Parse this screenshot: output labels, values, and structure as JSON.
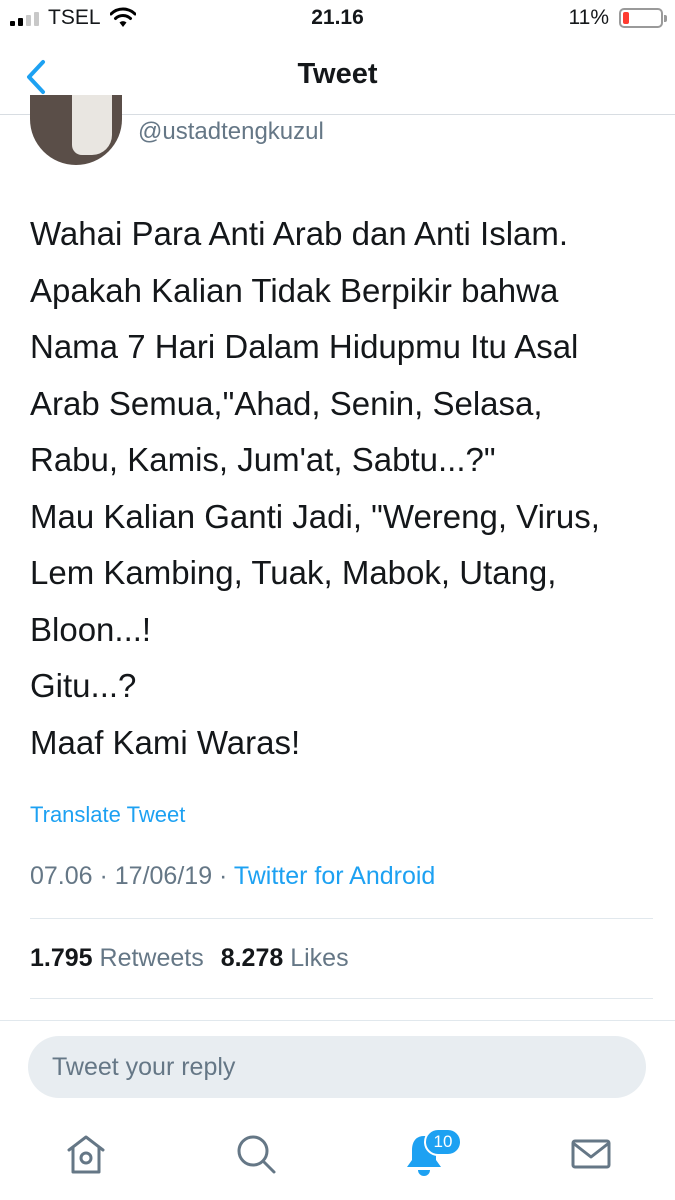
{
  "status_bar": {
    "carrier": "TSEL",
    "time": "21.16",
    "battery_percent": "11%",
    "battery_level": 0.11,
    "signal_bars": 2
  },
  "nav": {
    "title": "Tweet",
    "back_icon": "chevron-left-icon"
  },
  "tweet": {
    "handle": "@ustadtengkuzul",
    "text": "Wahai Para Anti Arab dan Anti Islam.\nApakah Kalian Tidak Berpikir bahwa\nNama 7 Hari Dalam Hidupmu Itu Asal\nArab Semua,\"Ahad, Senin, Selasa,\nRabu, Kamis, Jum'at, Sabtu...?\"\nMau Kalian Ganti Jadi, \"Wereng, Virus,\nLem Kambing, Tuak, Mabok, Utang,\nBloon...!\nGitu...?\nMaaf Kami Waras!",
    "translate_label": "Translate Tweet",
    "timestamp": "07.06 · 17/06/19 · ",
    "source": "Twitter for Android",
    "retweets_count": "1.795",
    "retweets_label": "Retweets",
    "likes_count": "8.278",
    "likes_label": "Likes"
  },
  "reply": {
    "placeholder": "Tweet your reply"
  },
  "tab_bar": {
    "tabs": [
      "home-icon",
      "search-icon",
      "notifications-icon",
      "messages-icon"
    ],
    "notification_badge": "10"
  },
  "colors": {
    "accent": "#1da1f2",
    "secondary_text": "#657786",
    "battery_low": "#ff3b30"
  }
}
